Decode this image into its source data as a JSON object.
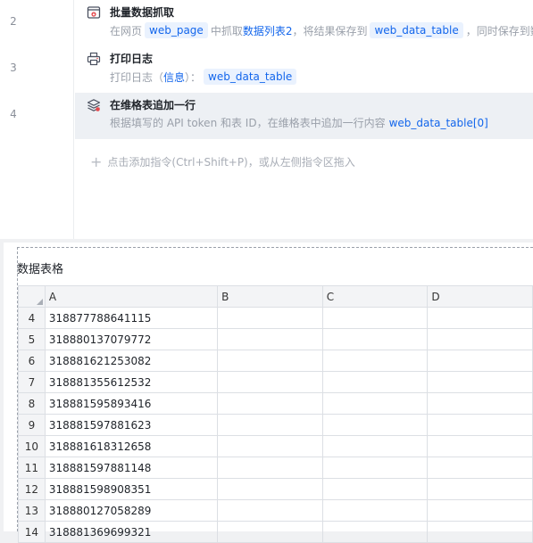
{
  "steps": [
    {
      "line": "2",
      "title": "批量数据抓取",
      "icon": "browser-grab-icon",
      "desc": {
        "p1": "在网页",
        "chip1": "web_page",
        "p2": "中抓取",
        "hl1": "数据列表2",
        "p3": "，将结果保存到",
        "chip2": "web_data_table",
        "p4": "，同时保存到数据"
      }
    },
    {
      "line": "3",
      "title": "打印日志",
      "icon": "printer-icon",
      "desc": {
        "p1": "打印日志（",
        "hl1": "信息",
        "p2": "）：",
        "chip1": "web_data_table"
      }
    },
    {
      "line": "4",
      "title": "在维格表追加一行",
      "icon": "layers-icon",
      "desc": {
        "p1": "根据填写的 API token 和表 ID，在维格表中追加一行内容",
        "hl1": "web_data_table[0]"
      }
    }
  ],
  "add_hint": "点击添加指令(Ctrl+Shift+P)，或从左侧指令区拖入",
  "grid": {
    "title": "数据表格",
    "columns": [
      "A",
      "B",
      "C",
      "D"
    ],
    "rows": [
      {
        "n": "4",
        "a": "318877788641115"
      },
      {
        "n": "5",
        "a": "318880137079772"
      },
      {
        "n": "6",
        "a": "318881621253082"
      },
      {
        "n": "7",
        "a": "318881355612532"
      },
      {
        "n": "8",
        "a": "318881595893416"
      },
      {
        "n": "9",
        "a": "318881597881623"
      },
      {
        "n": "10",
        "a": "318881618312658"
      },
      {
        "n": "11",
        "a": "318881597881148"
      },
      {
        "n": "12",
        "a": "318881598908351"
      },
      {
        "n": "13",
        "a": "318880127058289"
      },
      {
        "n": "14",
        "a": "318881369699321"
      }
    ]
  }
}
